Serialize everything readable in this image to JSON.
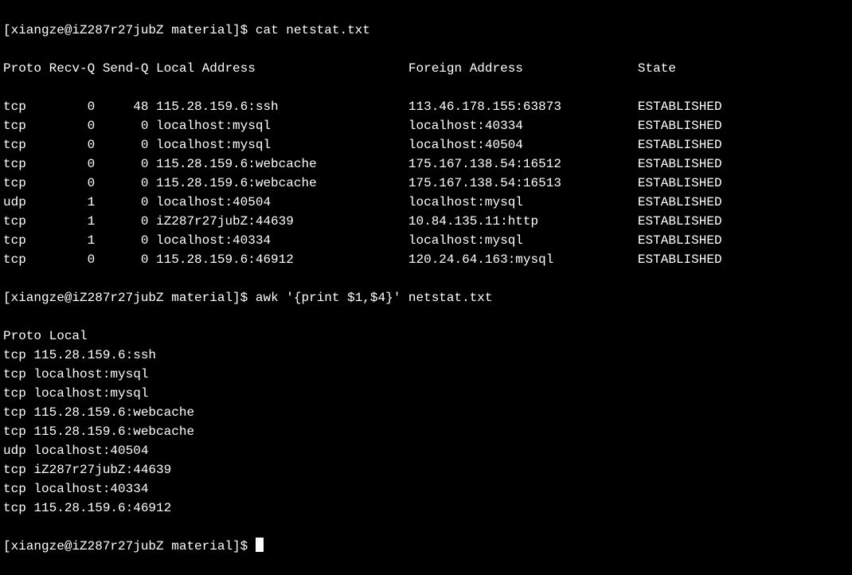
{
  "prompt1": "[xiangze@iZ287r27jubZ material]$ ",
  "command1": "cat netstat.txt",
  "netstat": {
    "header": {
      "proto": "Proto",
      "recvq": "Recv-Q",
      "sendq": "Send-Q",
      "local": "Local Address",
      "foreign": "Foreign Address",
      "state": "State"
    },
    "rows": [
      {
        "proto": "tcp",
        "recvq": "0",
        "sendq": "48",
        "local": "115.28.159.6:ssh",
        "foreign": "113.46.178.155:63873",
        "state": "ESTABLISHED"
      },
      {
        "proto": "tcp",
        "recvq": "0",
        "sendq": "0",
        "local": "localhost:mysql",
        "foreign": "localhost:40334",
        "state": "ESTABLISHED"
      },
      {
        "proto": "tcp",
        "recvq": "0",
        "sendq": "0",
        "local": "localhost:mysql",
        "foreign": "localhost:40504",
        "state": "ESTABLISHED"
      },
      {
        "proto": "tcp",
        "recvq": "0",
        "sendq": "0",
        "local": "115.28.159.6:webcache",
        "foreign": "175.167.138.54:16512",
        "state": "ESTABLISHED"
      },
      {
        "proto": "tcp",
        "recvq": "0",
        "sendq": "0",
        "local": "115.28.159.6:webcache",
        "foreign": "175.167.138.54:16513",
        "state": "ESTABLISHED"
      },
      {
        "proto": "udp",
        "recvq": "1",
        "sendq": "0",
        "local": "localhost:40504",
        "foreign": "localhost:mysql",
        "state": "ESTABLISHED"
      },
      {
        "proto": "tcp",
        "recvq": "1",
        "sendq": "0",
        "local": "iZ287r27jubZ:44639",
        "foreign": "10.84.135.11:http",
        "state": "ESTABLISHED"
      },
      {
        "proto": "tcp",
        "recvq": "1",
        "sendq": "0",
        "local": "localhost:40334",
        "foreign": "localhost:mysql",
        "state": "ESTABLISHED"
      },
      {
        "proto": "tcp",
        "recvq": "0",
        "sendq": "0",
        "local": "115.28.159.6:46912",
        "foreign": "120.24.64.163:mysql",
        "state": "ESTABLISHED"
      }
    ]
  },
  "prompt2": "[xiangze@iZ287r27jubZ material]$ ",
  "command2": "awk '{print $1,$4}' netstat.txt",
  "awk_output": [
    "Proto Local",
    "tcp 115.28.159.6:ssh",
    "tcp localhost:mysql",
    "tcp localhost:mysql",
    "tcp 115.28.159.6:webcache",
    "tcp 115.28.159.6:webcache",
    "udp localhost:40504",
    "tcp iZ287r27jubZ:44639",
    "tcp localhost:40334",
    "tcp 115.28.159.6:46912"
  ],
  "prompt3": "[xiangze@iZ287r27jubZ material]$ "
}
